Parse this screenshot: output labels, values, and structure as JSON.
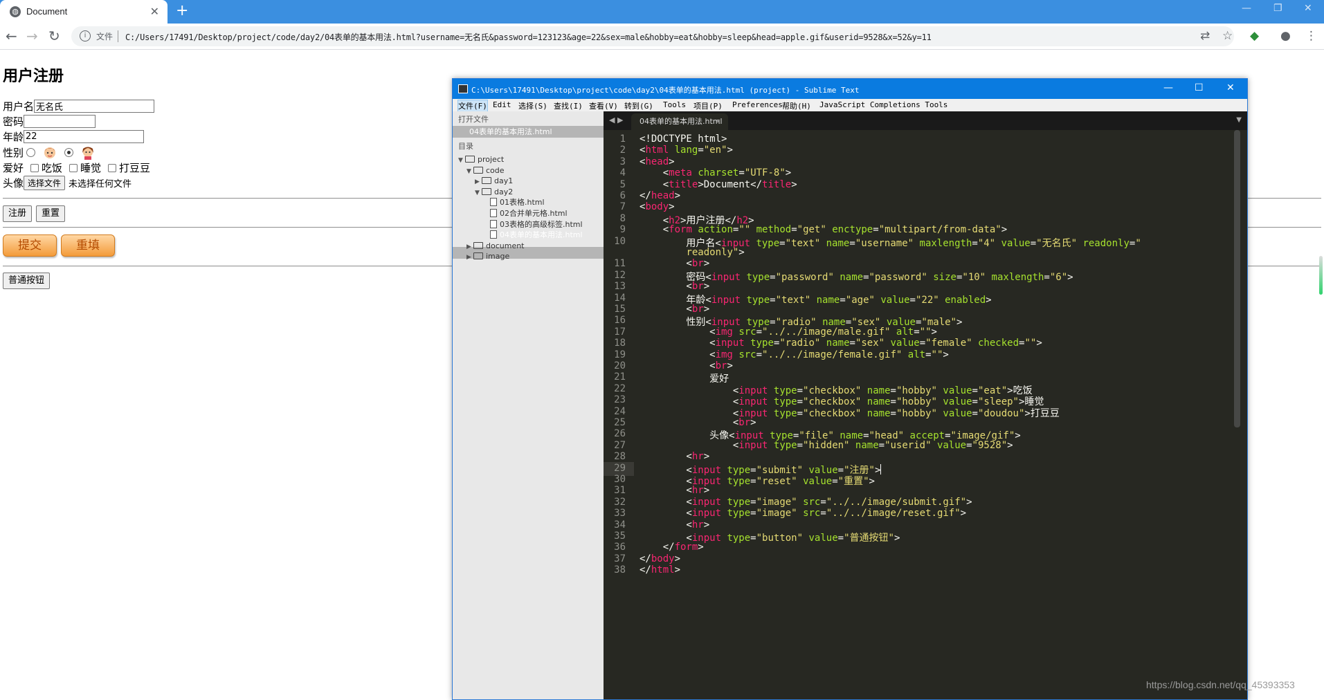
{
  "browser": {
    "tab_title": "Document",
    "favicon": "globe-icon",
    "new_tab": "+",
    "url_chip": "文件",
    "url": "C:/Users/17491/Desktop/project/code/day2/04表单的基本用法.html?username=无名氏&password=123123&age=22&sex=male&hobby=eat&hobby=sleep&head=apple.gif&userid=9528&x=52&y=11"
  },
  "page": {
    "heading": "用户注册",
    "username_label": "用户名",
    "username_value": "无名氏",
    "password_label": "密码",
    "age_label": "年龄",
    "age_value": "22",
    "sex_label": "性别",
    "hobby_label": "爱好",
    "hobby_eat": "吃饭",
    "hobby_sleep": "睡觉",
    "hobby_doudou": "打豆豆",
    "avatar_label": "头像",
    "file_button": "选择文件",
    "file_status": "未选择任何文件",
    "submit_label": "注册",
    "reset_label": "重置",
    "image_submit": "提交",
    "image_reset": "重填",
    "plain_button": "普通按钮"
  },
  "sublime": {
    "title": "C:\\Users\\17491\\Desktop\\project\\code\\day2\\04表单的基本用法.html (project) - Sublime Text",
    "menu": [
      "文件(F)",
      "Edit",
      "选择(S)",
      "查找(I)",
      "查看(V)",
      "转到(G)",
      "Tools",
      "项目(P)",
      "Preferences",
      "帮助(H)",
      "JavaScript Completions Tools"
    ],
    "sidebar": {
      "open_files_header": "打开文件",
      "open_file": "04表单的基本用法.html",
      "folders_header": "目录",
      "tree": [
        {
          "label": "project",
          "type": "folder",
          "depth": 0,
          "open": true
        },
        {
          "label": "code",
          "type": "folder",
          "depth": 1,
          "open": true
        },
        {
          "label": "day1",
          "type": "folder",
          "depth": 2,
          "open": false
        },
        {
          "label": "day2",
          "type": "folder",
          "depth": 2,
          "open": true
        },
        {
          "label": "01表格.html",
          "type": "file",
          "depth": 3
        },
        {
          "label": "02合并单元格.html",
          "type": "file",
          "depth": 3
        },
        {
          "label": "03表格的高级标签.html",
          "type": "file",
          "depth": 3
        },
        {
          "label": "04表单的基本用法.html",
          "type": "file",
          "depth": 3,
          "selected": true
        },
        {
          "label": "document",
          "type": "folder",
          "depth": 1,
          "open": false
        },
        {
          "label": "image",
          "type": "folder",
          "depth": 1,
          "open": false
        }
      ]
    },
    "tab_label": "04表单的基本用法.html",
    "current_line": "29",
    "code_lines": [
      {
        "n": "1",
        "html": "&lt;!DOCTYPE html&gt;"
      },
      {
        "n": "2",
        "html": "&lt;<span class='t'>html</span> <span class='a'>lang</span>=<span class='s'>\"en\"</span>&gt;"
      },
      {
        "n": "3",
        "html": "&lt;<span class='t'>head</span>&gt;"
      },
      {
        "n": "4",
        "html": "    &lt;<span class='t'>meta</span> <span class='a'>charset</span>=<span class='s'>\"UTF-8\"</span>&gt;"
      },
      {
        "n": "5",
        "html": "    &lt;<span class='t'>title</span>&gt;Document&lt;/<span class='t'>title</span>&gt;"
      },
      {
        "n": "6",
        "html": "&lt;/<span class='t'>head</span>&gt;"
      },
      {
        "n": "7",
        "html": "&lt;<span class='t'>body</span>&gt;"
      },
      {
        "n": "8",
        "html": "    &lt;<span class='t'>h2</span>&gt;用户注册&lt;/<span class='t'>h2</span>&gt;"
      },
      {
        "n": "9",
        "html": "    &lt;<span class='t'>form</span> <span class='a'>action</span>=<span class='s'>\"\"</span> <span class='a'>method</span>=<span class='s'>\"get\"</span> <span class='a'>enctype</span>=<span class='s'>\"multipart/from-data\"</span>&gt;"
      },
      {
        "n": "10",
        "html": "        用户名&lt;<span class='t'>input</span> <span class='a'>type</span>=<span class='s'>\"text\"</span> <span class='a'>name</span>=<span class='s'>\"username\"</span> <span class='a'>maxlength</span>=<span class='s'>\"4\"</span> <span class='a'>value</span>=<span class='s'>\"无名氏\"</span> <span class='a'>readonly</span>=<span class='s'>\"</span>"
      },
      {
        "n": "",
        "html": "        <span class='s'>readonly\"</span>&gt;"
      },
      {
        "n": "11",
        "html": "        &lt;<span class='t'>br</span>&gt;"
      },
      {
        "n": "12",
        "html": "        密码&lt;<span class='t'>input</span> <span class='a'>type</span>=<span class='s'>\"password\"</span> <span class='a'>name</span>=<span class='s'>\"password\"</span> <span class='a'>size</span>=<span class='s'>\"10\"</span> <span class='a'>maxlength</span>=<span class='s'>\"6\"</span>&gt;"
      },
      {
        "n": "13",
        "html": "        &lt;<span class='t'>br</span>&gt;"
      },
      {
        "n": "14",
        "html": "        年龄&lt;<span class='t'>input</span> <span class='a'>type</span>=<span class='s'>\"text\"</span> <span class='a'>name</span>=<span class='s'>\"age\"</span> <span class='a'>value</span>=<span class='s'>\"22\"</span> <span class='a'>enabled</span>&gt;"
      },
      {
        "n": "15",
        "html": "        &lt;<span class='t'>br</span>&gt;"
      },
      {
        "n": "16",
        "html": "        性别&lt;<span class='t'>input</span> <span class='a'>type</span>=<span class='s'>\"radio\"</span> <span class='a'>name</span>=<span class='s'>\"sex\"</span> <span class='a'>value</span>=<span class='s'>\"male\"</span>&gt;"
      },
      {
        "n": "17",
        "html": "            &lt;<span class='t'>img</span> <span class='a'>src</span>=<span class='s'>\"../../image/male.gif\"</span> <span class='a'>alt</span>=<span class='s'>\"\"</span>&gt;"
      },
      {
        "n": "18",
        "html": "            &lt;<span class='t'>input</span> <span class='a'>type</span>=<span class='s'>\"radio\"</span> <span class='a'>name</span>=<span class='s'>\"sex\"</span> <span class='a'>value</span>=<span class='s'>\"female\"</span> <span class='a'>checked</span>=<span class='s'>\"\"</span>&gt;"
      },
      {
        "n": "19",
        "html": "            &lt;<span class='t'>img</span> <span class='a'>src</span>=<span class='s'>\"../../image/female.gif\"</span> <span class='a'>alt</span>=<span class='s'>\"\"</span>&gt;"
      },
      {
        "n": "20",
        "html": "            &lt;<span class='t'>br</span>&gt;"
      },
      {
        "n": "21",
        "html": "            爱好"
      },
      {
        "n": "22",
        "html": "                &lt;<span class='t'>input</span> <span class='a'>type</span>=<span class='s'>\"checkbox\"</span> <span class='a'>name</span>=<span class='s'>\"hobby\"</span> <span class='a'>value</span>=<span class='s'>\"eat\"</span>&gt;吃饭"
      },
      {
        "n": "23",
        "html": "                &lt;<span class='t'>input</span> <span class='a'>type</span>=<span class='s'>\"checkbox\"</span> <span class='a'>name</span>=<span class='s'>\"hobby\"</span> <span class='a'>value</span>=<span class='s'>\"sleep\"</span>&gt;睡觉"
      },
      {
        "n": "24",
        "html": "                &lt;<span class='t'>input</span> <span class='a'>type</span>=<span class='s'>\"checkbox\"</span> <span class='a'>name</span>=<span class='s'>\"hobby\"</span> <span class='a'>value</span>=<span class='s'>\"doudou\"</span>&gt;打豆豆"
      },
      {
        "n": "25",
        "html": "                &lt;<span class='t'>br</span>&gt;"
      },
      {
        "n": "26",
        "html": "            头像&lt;<span class='t'>input</span> <span class='a'>type</span>=<span class='s'>\"file\"</span> <span class='a'>name</span>=<span class='s'>\"head\"</span> <span class='a'>accept</span>=<span class='s'>\"image/gif\"</span>&gt;"
      },
      {
        "n": "27",
        "html": "                &lt;<span class='t'>input</span> <span class='a'>type</span>=<span class='s'>\"hidden\"</span> <span class='a'>name</span>=<span class='s'>\"userid\"</span> <span class='a'>value</span>=<span class='s'>\"9528\"</span>&gt;"
      },
      {
        "n": "28",
        "html": "        &lt;<span class='t'>hr</span>&gt;"
      },
      {
        "n": "29",
        "html": "        &lt;<span class='t'>input</span> <span class='a'>type</span>=<span class='s'>\"submit\"</span> <span class='a'>value</span>=<span class='s'>\"注册\"</span>&gt;<span class='caret'></span>"
      },
      {
        "n": "30",
        "html": "        &lt;<span class='t'>input</span> <span class='a'>type</span>=<span class='s'>\"reset\"</span> <span class='a'>value</span>=<span class='s'>\"重置\"</span>&gt;"
      },
      {
        "n": "31",
        "html": "        &lt;<span class='t'>hr</span>&gt;"
      },
      {
        "n": "32",
        "html": "        &lt;<span class='t'>input</span> <span class='a'>type</span>=<span class='s'>\"image\"</span> <span class='a'>src</span>=<span class='s'>\"../../image/submit.gif\"</span>&gt;"
      },
      {
        "n": "33",
        "html": "        &lt;<span class='t'>input</span> <span class='a'>type</span>=<span class='s'>\"image\"</span> <span class='a'>src</span>=<span class='s'>\"../../image/reset.gif\"</span>&gt;"
      },
      {
        "n": "34",
        "html": "        &lt;<span class='t'>hr</span>&gt;"
      },
      {
        "n": "35",
        "html": "        &lt;<span class='t'>input</span> <span class='a'>type</span>=<span class='s'>\"button\"</span> <span class='a'>value</span>=<span class='s'>\"普通按钮\"</span>&gt;"
      },
      {
        "n": "36",
        "html": "    &lt;/<span class='t'>form</span>&gt;"
      },
      {
        "n": "37",
        "html": "&lt;/<span class='t'>body</span>&gt;"
      },
      {
        "n": "38",
        "html": "&lt;/<span class='t'>html</span>&gt;"
      }
    ]
  },
  "watermark": "https://blog.csdn.net/qq_45393353"
}
